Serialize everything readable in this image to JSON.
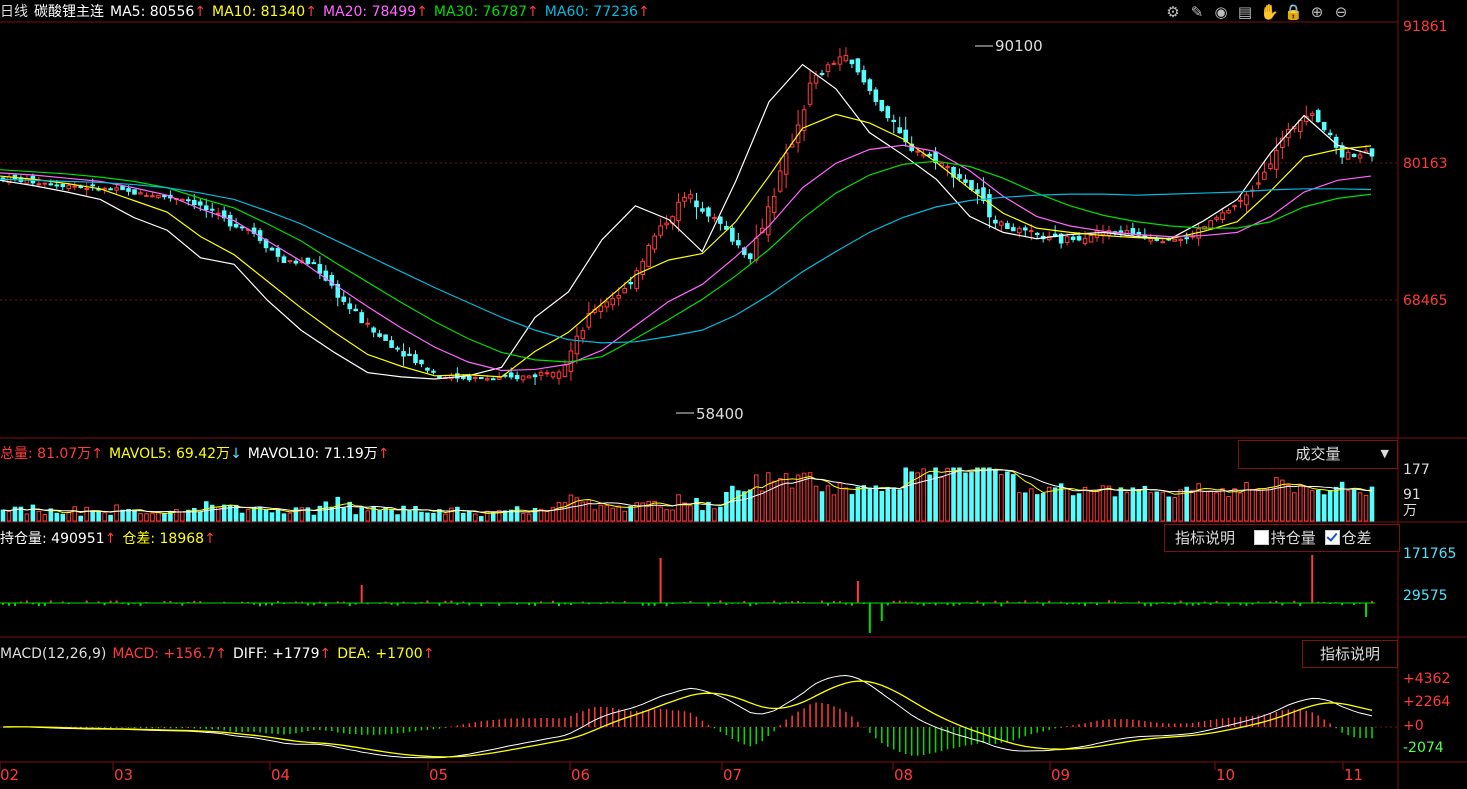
{
  "main_header": {
    "period": "日线",
    "symbol": "碳酸锂主连",
    "ma5": "MA5: 80556",
    "ma10": "MA10: 81340",
    "ma20": "MA20: 78499",
    "ma30": "MA30: 76787",
    "ma60": "MA60: 77236",
    "up_arrow": "↑",
    "down_arrow": "↓"
  },
  "toolbar_icons": [
    "gear-icon",
    "pencil-icon",
    "eye-icon",
    "layers-icon",
    "hand-icon",
    "lock-icon",
    "zoom-in-icon",
    "zoom-out-icon"
  ],
  "price_axis": [
    "91861",
    "80163",
    "68465"
  ],
  "annotations": {
    "high": "90100",
    "low": "58400"
  },
  "volume_panel": {
    "total": "总量: 81.07万",
    "mavol5": "MAVOL5: 69.42万",
    "mavol10": "MAVOL10: 71.19万",
    "selector": "成交量",
    "axis": [
      "177",
      "91",
      "万"
    ]
  },
  "oi_panel": {
    "oi": "持仓量: 490951",
    "diff": "仓差: 18968",
    "help_btn": "指标说明",
    "chk_oi": "持仓量",
    "chk_diff": "仓差",
    "axis": [
      "171765",
      "29575"
    ]
  },
  "macd_panel": {
    "name": "MACD(12,26,9)",
    "macd": "MACD: +156.7",
    "diff": "DIFF: +1779",
    "dea": "DEA: +1700",
    "help_btn": "指标说明",
    "axis": [
      "+4362",
      "+2264",
      "+0",
      "-2074"
    ]
  },
  "x_axis": [
    "02",
    "03",
    "04",
    "05",
    "06",
    "07",
    "08",
    "09",
    "10",
    "11"
  ],
  "colors": {
    "up": "#ff3b3b",
    "down": "#54ffff",
    "ma5": "#ffffff",
    "ma10": "#ffff00",
    "ma20": "#ff66ff",
    "ma30": "#00dd00",
    "ma60": "#00bbdd",
    "grid": "#7a1010"
  },
  "chart_data": {
    "type": "candlestick",
    "x_ticks": [
      "02",
      "03",
      "04",
      "05",
      "06",
      "07",
      "08",
      "09",
      "10",
      "11"
    ],
    "price_range": [
      54600,
      93000
    ],
    "price_ticks": [
      91861,
      80163,
      68465
    ],
    "high_label": 90100,
    "low_label": 58400,
    "close_path": [
      [
        0,
        78300
      ],
      [
        2,
        77700
      ],
      [
        4,
        77000
      ],
      [
        6,
        76300
      ],
      [
        7,
        74500
      ],
      [
        8,
        73400
      ],
      [
        9,
        70500
      ],
      [
        10,
        70300
      ],
      [
        11,
        66500
      ],
      [
        12,
        63600
      ],
      [
        13,
        61700
      ],
      [
        14,
        59700
      ],
      [
        15,
        59500
      ],
      [
        16,
        59400
      ],
      [
        17,
        59700
      ],
      [
        18,
        60600
      ],
      [
        19,
        66000
      ],
      [
        20,
        67800
      ],
      [
        21,
        73100
      ],
      [
        22,
        76800
      ],
      [
        23,
        74100
      ],
      [
        24,
        70800
      ],
      [
        25,
        78700
      ],
      [
        26,
        87400
      ],
      [
        27,
        90000
      ],
      [
        28,
        86000
      ],
      [
        29,
        81500
      ],
      [
        30,
        80000
      ],
      [
        31,
        77800
      ],
      [
        32,
        74000
      ],
      [
        33,
        73000
      ],
      [
        34,
        72400
      ],
      [
        35,
        73100
      ],
      [
        36,
        73300
      ],
      [
        37,
        72700
      ],
      [
        38,
        72500
      ],
      [
        39,
        74500
      ],
      [
        40,
        76600
      ],
      [
        41,
        81500
      ],
      [
        42,
        85000
      ],
      [
        43,
        80600
      ],
      [
        44,
        80556
      ]
    ],
    "series": [
      {
        "name": "MA5",
        "values": [
          78100,
          77600,
          77000,
          76300,
          74600,
          73400,
          70800,
          70200,
          66800,
          64000,
          61900,
          60000,
          59600,
          59400,
          59700,
          60500,
          65200,
          67600,
          72500,
          75700,
          74400,
          71400,
          78000,
          85500,
          89000,
          86700,
          82600,
          80500,
          78200,
          74700,
          73200,
          72600,
          73000,
          73200,
          72800,
          72600,
          74300,
          76300,
          80700,
          84200,
          81400,
          80556
        ]
      },
      {
        "name": "MA10",
        "values": [
          78500,
          78200,
          77800,
          77300,
          76200,
          75100,
          72800,
          71100,
          68600,
          66100,
          63800,
          61700,
          60600,
          59700,
          59800,
          59600,
          62000,
          63800,
          66500,
          69200,
          70600,
          71200,
          74200,
          78500,
          83000,
          84300,
          83500,
          82000,
          79800,
          77300,
          75000,
          73600,
          73200,
          72900,
          72700,
          72600,
          73300,
          74200,
          77100,
          80300,
          81000,
          81340
        ]
      },
      {
        "name": "MA20",
        "values": [
          78800,
          78600,
          78300,
          78000,
          77400,
          76700,
          75400,
          74300,
          72400,
          70500,
          68300,
          66200,
          64200,
          62400,
          61000,
          60200,
          60300,
          60800,
          62100,
          64400,
          66700,
          68300,
          70900,
          73800,
          77400,
          79700,
          81000,
          81400,
          80800,
          79000,
          76600,
          74700,
          73800,
          73300,
          73000,
          72800,
          72900,
          73200,
          74700,
          77000,
          78100,
          78499
        ]
      },
      {
        "name": "MA30",
        "values": [
          79100,
          78900,
          78700,
          78400,
          78000,
          77400,
          76400,
          75500,
          74000,
          72400,
          70400,
          68500,
          66600,
          64800,
          63200,
          61900,
          61200,
          61000,
          61500,
          63200,
          65000,
          66900,
          69100,
          71600,
          74500,
          76900,
          78600,
          79600,
          79900,
          79400,
          78300,
          76900,
          75700,
          74800,
          74200,
          73800,
          73600,
          73600,
          74200,
          75600,
          76400,
          76787
        ]
      },
      {
        "name": "MA60",
        "values": [
          78200,
          78100,
          78000,
          77900,
          77700,
          77400,
          76900,
          76300,
          75200,
          74000,
          72500,
          71000,
          69500,
          68000,
          66600,
          65200,
          64000,
          63100,
          62800,
          62900,
          63400,
          64000,
          65400,
          67300,
          69500,
          71400,
          73200,
          74600,
          75600,
          76200,
          76500,
          76700,
          76800,
          76800,
          76700,
          76800,
          76900,
          77000,
          77200,
          77300,
          77300,
          77236
        ]
      }
    ],
    "volume": {
      "unit": "万",
      "total": 81.07,
      "mavol5": 69.42,
      "mavol10": 71.19,
      "axis_max": 177
    },
    "macd": {
      "params": "12,26,9",
      "macd": 156.7,
      "diff": 1779,
      "dea": 1700,
      "axis": [
        4362,
        2264,
        0,
        -2074
      ]
    }
  }
}
